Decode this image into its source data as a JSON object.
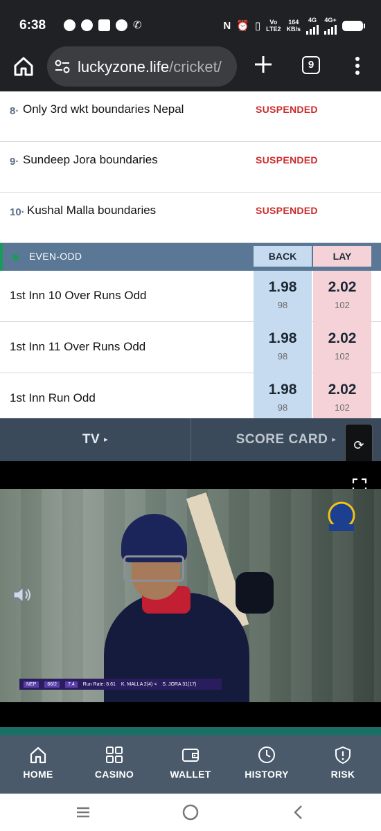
{
  "status_bar": {
    "time": "6:38",
    "notification_icons": [
      "whatsapp-icon",
      "whatsapp-icon",
      "square-app-icon",
      "facebook-icon",
      "phone-icon"
    ],
    "network_label_top": "Vo",
    "network_label_bottom": "LTE2",
    "speed_value": "164",
    "speed_unit": "KB/s",
    "sim1": "4G",
    "sim2": "4G+"
  },
  "browser": {
    "url_host": "luckyzone.life",
    "url_path": "/cricket/",
    "tab_count": "9"
  },
  "fancy_markets": [
    {
      "index": "8",
      "name": "Only 3rd wkt boundaries Nepal",
      "status": "SUSPENDED"
    },
    {
      "index": "9",
      "name": "Sundeep Jora boundaries",
      "status": "SUSPENDED"
    },
    {
      "index": "10",
      "name": "Kushal Malla boundaries",
      "status": "SUSPENDED"
    }
  ],
  "even_odd": {
    "title": "EVEN-ODD",
    "back_label": "BACK",
    "lay_label": "LAY",
    "rows": [
      {
        "name": "1st Inn 10 Over Runs Odd",
        "back_price": "1.98",
        "back_size": "98",
        "lay_price": "2.02",
        "lay_size": "102"
      },
      {
        "name": "1st Inn 11 Over Runs Odd",
        "back_price": "1.98",
        "back_size": "98",
        "lay_price": "2.02",
        "lay_size": "102"
      },
      {
        "name": "1st Inn Run Odd",
        "back_price": "1.98",
        "back_size": "98",
        "lay_price": "2.02",
        "lay_size": "102"
      }
    ]
  },
  "media_tabs": {
    "tv_label": "TV",
    "scorecard_label": "SCORE CARD",
    "arrow": "▸"
  },
  "video": {
    "score_team": "NEP",
    "score_value": "66/2",
    "score_overs": "7.4",
    "run_rate": "Run Rate: 8.61",
    "batter1": "K. MALLA 2(4) <",
    "batter2": "S. JORA 31(17)"
  },
  "bottom_nav": [
    {
      "label": "HOME",
      "icon": "home-icon"
    },
    {
      "label": "CASINO",
      "icon": "grid-icon"
    },
    {
      "label": "WALLET",
      "icon": "wallet-icon"
    },
    {
      "label": "HISTORY",
      "icon": "clock-icon"
    },
    {
      "label": "RISK",
      "icon": "shield-alert-icon"
    }
  ],
  "colors": {
    "back": "#c6dbef",
    "lay": "#f4d2d8",
    "suspended": "#cc2b2b",
    "section_header": "#5a7896",
    "nav": "#4a5a6b"
  }
}
